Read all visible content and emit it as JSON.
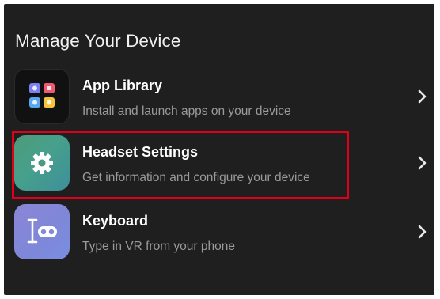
{
  "screen": {
    "title": "Manage Your Device"
  },
  "items": [
    {
      "label": "App Library",
      "description": "Install and launch apps on your device",
      "icon": "app-grid-icon"
    },
    {
      "label": "Headset Settings",
      "description": "Get information and configure your device",
      "icon": "gear-icon"
    },
    {
      "label": "Keyboard",
      "description": "Type in VR from your phone",
      "icon": "keyboard-icon"
    }
  ],
  "colors": {
    "background": "#1f1f1f",
    "highlight": "#e0001b",
    "settings_tile": "#46a08c",
    "keyboard_tile": "#8289d9"
  }
}
